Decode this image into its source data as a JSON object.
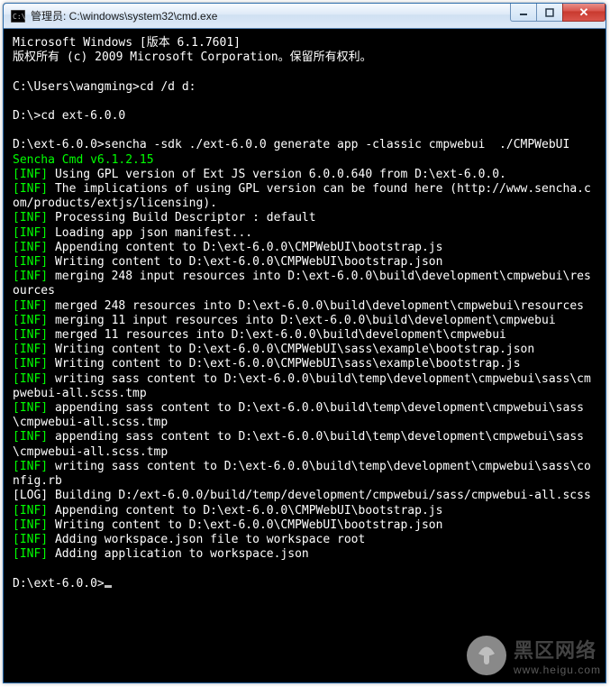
{
  "window": {
    "title": "管理员: C:\\windows\\system32\\cmd.exe"
  },
  "term": {
    "lines": [
      [
        [
          "w",
          "Microsoft Windows [版本 6.1.7601]"
        ]
      ],
      [
        [
          "w",
          "版权所有 (c) 2009 Microsoft Corporation。保留所有权利。"
        ]
      ],
      [
        [
          "w",
          ""
        ]
      ],
      [
        [
          "w",
          "C:\\Users\\wangming>cd /d d:"
        ]
      ],
      [
        [
          "w",
          ""
        ]
      ],
      [
        [
          "w",
          "D:\\>cd ext-6.0.0"
        ]
      ],
      [
        [
          "w",
          ""
        ]
      ],
      [
        [
          "w",
          "D:\\ext-6.0.0>sencha -sdk ./ext-6.0.0 generate app -classic cmpwebui  ./CMPWebUI"
        ]
      ],
      [
        [
          "g",
          "Sencha Cmd v6.1.2.15"
        ]
      ],
      [
        [
          "g",
          "[INF]"
        ],
        [
          "w",
          " Using GPL version of Ext JS version 6.0.0.640 from D:\\ext-6.0.0."
        ]
      ],
      [
        [
          "g",
          "[INF]"
        ],
        [
          "w",
          " The implications of using GPL version can be found here (http://www.sencha.com/products/extjs/licensing)."
        ]
      ],
      [
        [
          "g",
          "[INF]"
        ],
        [
          "w",
          " Processing Build Descriptor : default"
        ]
      ],
      [
        [
          "g",
          "[INF]"
        ],
        [
          "w",
          " Loading app json manifest..."
        ]
      ],
      [
        [
          "g",
          "[INF]"
        ],
        [
          "w",
          " Appending content to D:\\ext-6.0.0\\CMPWebUI\\bootstrap.js"
        ]
      ],
      [
        [
          "g",
          "[INF]"
        ],
        [
          "w",
          " Writing content to D:\\ext-6.0.0\\CMPWebUI\\bootstrap.json"
        ]
      ],
      [
        [
          "g",
          "[INF]"
        ],
        [
          "w",
          " merging 248 input resources into D:\\ext-6.0.0\\build\\development\\cmpwebui\\resources"
        ]
      ],
      [
        [
          "g",
          "[INF]"
        ],
        [
          "w",
          " merged 248 resources into D:\\ext-6.0.0\\build\\development\\cmpwebui\\resources"
        ]
      ],
      [
        [
          "g",
          "[INF]"
        ],
        [
          "w",
          " merging 11 input resources into D:\\ext-6.0.0\\build\\development\\cmpwebui"
        ]
      ],
      [
        [
          "g",
          "[INF]"
        ],
        [
          "w",
          " merged 11 resources into D:\\ext-6.0.0\\build\\development\\cmpwebui"
        ]
      ],
      [
        [
          "g",
          "[INF]"
        ],
        [
          "w",
          " Writing content to D:\\ext-6.0.0\\CMPWebUI\\sass\\example\\bootstrap.json"
        ]
      ],
      [
        [
          "g",
          "[INF]"
        ],
        [
          "w",
          " Writing content to D:\\ext-6.0.0\\CMPWebUI\\sass\\example\\bootstrap.js"
        ]
      ],
      [
        [
          "g",
          "[INF]"
        ],
        [
          "w",
          " writing sass content to D:\\ext-6.0.0\\build\\temp\\development\\cmpwebui\\sass\\cmpwebui-all.scss.tmp"
        ]
      ],
      [
        [
          "g",
          "[INF]"
        ],
        [
          "w",
          " appending sass content to D:\\ext-6.0.0\\build\\temp\\development\\cmpwebui\\sass\\cmpwebui-all.scss.tmp"
        ]
      ],
      [
        [
          "g",
          "[INF]"
        ],
        [
          "w",
          " appending sass content to D:\\ext-6.0.0\\build\\temp\\development\\cmpwebui\\sass\\cmpwebui-all.scss.tmp"
        ]
      ],
      [
        [
          "g",
          "[INF]"
        ],
        [
          "w",
          " writing sass content to D:\\ext-6.0.0\\build\\temp\\development\\cmpwebui\\sass\\config.rb"
        ]
      ],
      [
        [
          "w",
          "[LOG] Building D:/ext-6.0.0/build/temp/development/cmpwebui/sass/cmpwebui-all.scss"
        ]
      ],
      [
        [
          "g",
          "[INF]"
        ],
        [
          "w",
          " Appending content to D:\\ext-6.0.0\\CMPWebUI\\bootstrap.js"
        ]
      ],
      [
        [
          "g",
          "[INF]"
        ],
        [
          "w",
          " Writing content to D:\\ext-6.0.0\\CMPWebUI\\bootstrap.json"
        ]
      ],
      [
        [
          "g",
          "[INF]"
        ],
        [
          "w",
          " Adding workspace.json file to workspace root"
        ]
      ],
      [
        [
          "g",
          "[INF]"
        ],
        [
          "w",
          " Adding application to workspace.json"
        ]
      ],
      [
        [
          "w",
          ""
        ]
      ],
      [
        [
          "w",
          "D:\\ext-6.0.0>"
        ]
      ]
    ]
  },
  "watermark": {
    "label1": "黑区网络",
    "label2": "www.heigu.com"
  }
}
